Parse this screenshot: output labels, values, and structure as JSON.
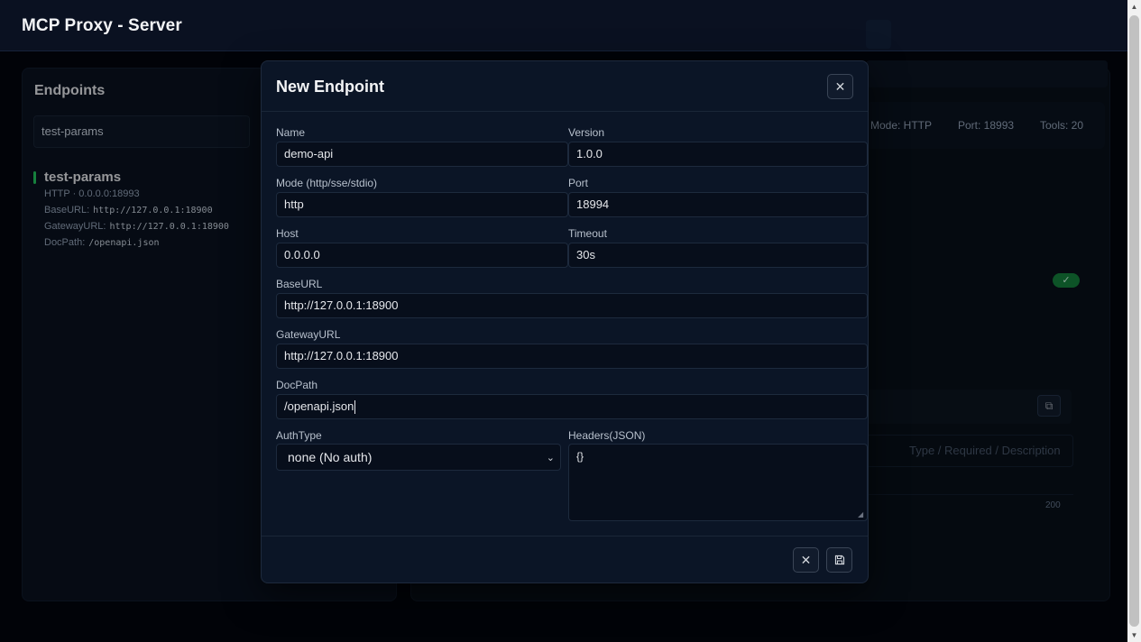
{
  "app": {
    "title": "MCP Proxy - Server"
  },
  "sidebar": {
    "title": "Endpoints",
    "search_value": "test-params",
    "endpoints": [
      {
        "name": "test-params",
        "summary": "HTTP · 0.0.0.0:18993",
        "base_url_label": "BaseURL:",
        "base_url": "http://127.0.0.1:18900",
        "gateway_url_label": "GatewayURL:",
        "gateway_url": "http://127.0.0.1:18900",
        "doc_path_label": "DocPath:",
        "doc_path": "/openapi.json",
        "status_color": "#22c55e"
      }
    ]
  },
  "detail": {
    "mode": "Mode: HTTP",
    "port": "Port: 18993",
    "tools": "Tools: 20",
    "params_header": "Type / Required / Description",
    "status_code": "200"
  },
  "modal": {
    "title": "New Endpoint",
    "fields": {
      "name": {
        "label": "Name",
        "value": "demo-api"
      },
      "version": {
        "label": "Version",
        "value": "1.0.0"
      },
      "mode": {
        "label": "Mode (http/sse/stdio)",
        "value": "http"
      },
      "port": {
        "label": "Port",
        "value": "18994"
      },
      "host": {
        "label": "Host",
        "value": "0.0.0.0"
      },
      "timeout": {
        "label": "Timeout",
        "value": "30s"
      },
      "base_url": {
        "label": "BaseURL",
        "value": "http://127.0.0.1:18900"
      },
      "gateway_url": {
        "label": "GatewayURL",
        "value": "http://127.0.0.1:18900"
      },
      "doc_path": {
        "label": "DocPath",
        "value": "/openapi.json"
      },
      "auth_type": {
        "label": "AuthType",
        "value": "none (No auth)"
      },
      "headers": {
        "label": "Headers(JSON)",
        "value": "{}"
      }
    },
    "icons": {
      "close": "close-icon",
      "cancel": "x-icon",
      "save": "save-icon",
      "select": "chevron-down-icon"
    }
  },
  "colors": {
    "accent": "#22c55e",
    "background": "#03060d",
    "modal": "#0b1526"
  }
}
